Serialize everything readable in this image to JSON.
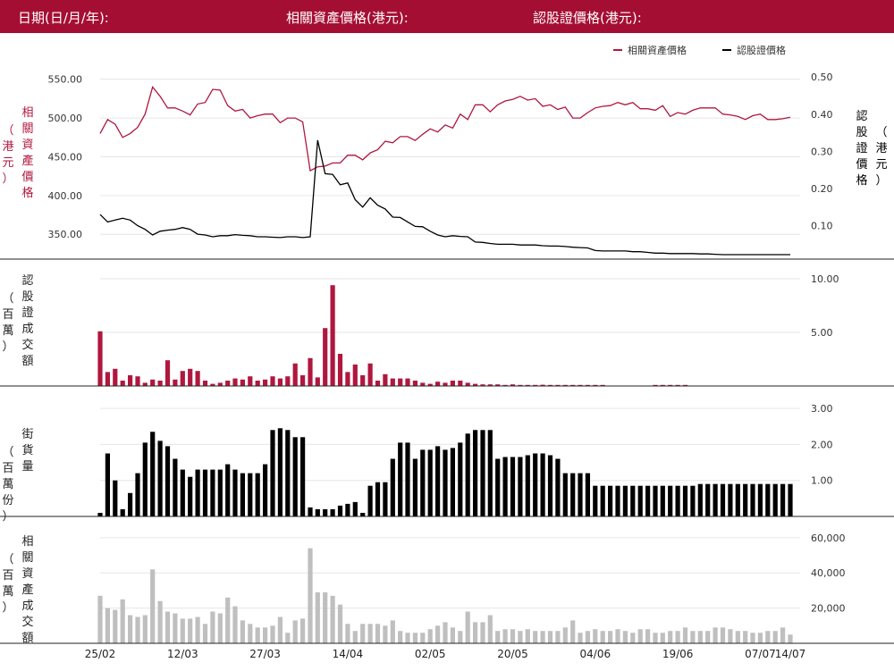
{
  "header": {
    "date_label": "日期(日/月/年):",
    "underlying_price_label": "相關資產價格(港元):",
    "warrant_price_label": "認股證價格(港元):"
  },
  "colors": {
    "header_bg": "#a50e33",
    "underlying": "#b0173f",
    "warrant": "#000000",
    "turnover_bar": "#b0173f",
    "street_bar": "#000000",
    "underlying_turnover_bar": "#bfbfbf",
    "grid": "#e6e6e6"
  },
  "chart_data": [
    {
      "type": "line",
      "title": "",
      "legend": [
        "相關資產價格",
        "認股證價格"
      ],
      "legend_position": "top-right",
      "ylabel_left": "相關資產價格（港元）",
      "ylabel_right": "認股證價格（港元）",
      "ylim_left": [
        318,
        560
      ],
      "ylim_right": [
        0.01,
        0.515
      ],
      "yticks_left": [
        "350.00",
        "400.00",
        "450.00",
        "500.00",
        "550.00"
      ],
      "yticks_right": [
        "0.10",
        "0.20",
        "0.30",
        "0.40",
        "0.50"
      ],
      "grid": true,
      "series": [
        {
          "name": "相關資產價格",
          "axis": "left",
          "values": [
            480,
            498,
            492,
            475,
            480,
            488,
            505,
            540,
            528,
            513,
            513,
            509,
            504,
            518,
            520,
            537,
            536,
            516,
            509,
            511,
            500,
            503,
            505,
            505,
            494,
            500,
            500,
            495,
            432,
            437,
            438,
            442,
            442,
            452,
            452,
            446,
            455,
            459,
            470,
            468,
            476,
            476,
            471,
            479,
            486,
            482,
            491,
            487,
            505,
            498,
            517,
            517,
            508,
            517,
            522,
            524,
            528,
            523,
            525,
            515,
            517,
            511,
            514,
            500,
            500,
            507,
            513,
            515,
            516,
            520,
            517,
            520,
            512,
            512,
            510,
            516,
            502,
            507,
            505,
            510,
            513,
            513,
            513,
            505,
            504,
            502,
            498,
            503,
            505,
            498,
            498,
            499,
            501
          ]
        },
        {
          "name": "認股證價格",
          "axis": "right",
          "values": [
            0.13,
            0.11,
            0.115,
            0.12,
            0.115,
            0.1,
            0.09,
            0.075,
            0.085,
            0.088,
            0.09,
            0.095,
            0.09,
            0.077,
            0.075,
            0.07,
            0.073,
            0.073,
            0.076,
            0.074,
            0.073,
            0.07,
            0.07,
            0.069,
            0.068,
            0.07,
            0.07,
            0.068,
            0.07,
            0.33,
            0.24,
            0.238,
            0.21,
            0.215,
            0.17,
            0.15,
            0.175,
            0.155,
            0.145,
            0.123,
            0.122,
            0.11,
            0.098,
            0.097,
            0.085,
            0.075,
            0.07,
            0.073,
            0.071,
            0.07,
            0.056,
            0.055,
            0.052,
            0.05,
            0.05,
            0.05,
            0.048,
            0.048,
            0.048,
            0.046,
            0.045,
            0.045,
            0.044,
            0.042,
            0.041,
            0.04,
            0.033,
            0.032,
            0.032,
            0.032,
            0.032,
            0.03,
            0.03,
            0.028,
            0.026,
            0.026,
            0.025,
            0.025,
            0.025,
            0.025,
            0.024,
            0.024,
            0.023,
            0.022,
            0.022,
            0.022,
            0.022,
            0.022,
            0.022,
            0.022,
            0.022,
            0.022,
            0.022
          ]
        }
      ]
    },
    {
      "type": "bar",
      "ylabel": "認股證成交額（百萬）",
      "ylim": [
        0,
        11
      ],
      "yticks": [
        "5.00",
        "10.00"
      ],
      "series": [
        {
          "name": "認股證成交額",
          "values": [
            5.1,
            1.3,
            1.6,
            0.5,
            1,
            0.9,
            0.3,
            0.6,
            0.5,
            2.4,
            0.6,
            1.4,
            1.6,
            1.4,
            0.5,
            0.2,
            0.3,
            0.5,
            0.7,
            0.6,
            0.9,
            0.5,
            0.6,
            0.9,
            0.7,
            0.9,
            2.1,
            1,
            2.6,
            0.8,
            5.4,
            9.4,
            3,
            1.3,
            2,
            1,
            2.1,
            0.5,
            1.1,
            0.7,
            0.7,
            0.7,
            0.5,
            0.3,
            0.2,
            0.4,
            0.3,
            0.5,
            0.5,
            0.3,
            0.2,
            0.15,
            0.15,
            0.15,
            0.1,
            0.15,
            0.1,
            0.1,
            0.1,
            0.12,
            0.1,
            0.1,
            0.1,
            0.1,
            0.1,
            0.1,
            0.1,
            0.1,
            0,
            0,
            0,
            0,
            0,
            0,
            0.1,
            0.1,
            0.1,
            0.1,
            0.1,
            0,
            0,
            0,
            0,
            0,
            0,
            0,
            0,
            0,
            0,
            0,
            0,
            0,
            0
          ]
        }
      ]
    },
    {
      "type": "bar",
      "ylabel": "街貨量（百萬份）",
      "ylim": [
        0,
        3.3
      ],
      "yticks": [
        "1.00",
        "2.00",
        "3.00"
      ],
      "series": [
        {
          "name": "街貨量",
          "values": [
            0.1,
            1.75,
            1,
            0.2,
            0.65,
            1.2,
            2.05,
            2.35,
            2.1,
            1.95,
            1.6,
            1.3,
            1.1,
            1.3,
            1.3,
            1.3,
            1.3,
            1.45,
            1.3,
            1.2,
            1.2,
            1.2,
            1.45,
            2.4,
            2.45,
            2.4,
            2.2,
            2.2,
            0.25,
            0.2,
            0.2,
            0.2,
            0.3,
            0.35,
            0.4,
            0.1,
            0.85,
            0.95,
            0.95,
            1.6,
            2.05,
            2.05,
            1.6,
            1.85,
            1.85,
            1.95,
            1.85,
            1.9,
            2.05,
            2.3,
            2.4,
            2.4,
            2.4,
            1.6,
            1.65,
            1.65,
            1.65,
            1.7,
            1.75,
            1.75,
            1.7,
            1.6,
            1.2,
            1.2,
            1.2,
            1.2,
            0.85,
            0.85,
            0.85,
            0.85,
            0.85,
            0.85,
            0.85,
            0.85,
            0.85,
            0.85,
            0.85,
            0.85,
            0.85,
            0.85,
            0.9,
            0.9,
            0.9,
            0.9,
            0.9,
            0.9,
            0.9,
            0.9,
            0.9,
            0.9,
            0.9,
            0.9,
            0.9
          ]
        }
      ]
    },
    {
      "type": "bar",
      "ylabel": "相關資產成交額（百萬）",
      "ylim": [
        0,
        66000
      ],
      "yticks": [
        "20,000",
        "40,000",
        "60,000"
      ],
      "series": [
        {
          "name": "相關資產成交額",
          "values": [
            27000,
            20000,
            19000,
            25000,
            16000,
            15000,
            16000,
            42000,
            24000,
            18000,
            17000,
            14000,
            14000,
            15000,
            11000,
            18000,
            17000,
            26000,
            21000,
            13000,
            11000,
            9000,
            9000,
            10000,
            15000,
            6000,
            13000,
            14000,
            54000,
            29000,
            29000,
            27000,
            22000,
            11000,
            7000,
            11000,
            11000,
            11000,
            10000,
            13000,
            7000,
            6000,
            6000,
            6000,
            8000,
            10000,
            12000,
            9000,
            7000,
            18000,
            12000,
            12000,
            16000,
            7000,
            8000,
            8000,
            7000,
            8000,
            7000,
            7000,
            7000,
            7000,
            9000,
            13000,
            6000,
            7000,
            8000,
            7000,
            7000,
            8000,
            7000,
            6000,
            8000,
            8000,
            6000,
            6000,
            7000,
            7000,
            9000,
            7000,
            7000,
            7000,
            9000,
            9000,
            8000,
            7000,
            7000,
            6000,
            6000,
            7000,
            7000,
            9000,
            5000
          ]
        }
      ]
    }
  ],
  "x_axis": {
    "tick_labels": [
      "25/02",
      "12/03",
      "27/03",
      "14/04",
      "02/05",
      "20/05",
      "04/06",
      "19/06",
      "07/07",
      "14/07"
    ],
    "tick_indices": [
      0,
      11,
      22,
      33,
      44,
      55,
      66,
      77,
      88,
      92
    ]
  }
}
